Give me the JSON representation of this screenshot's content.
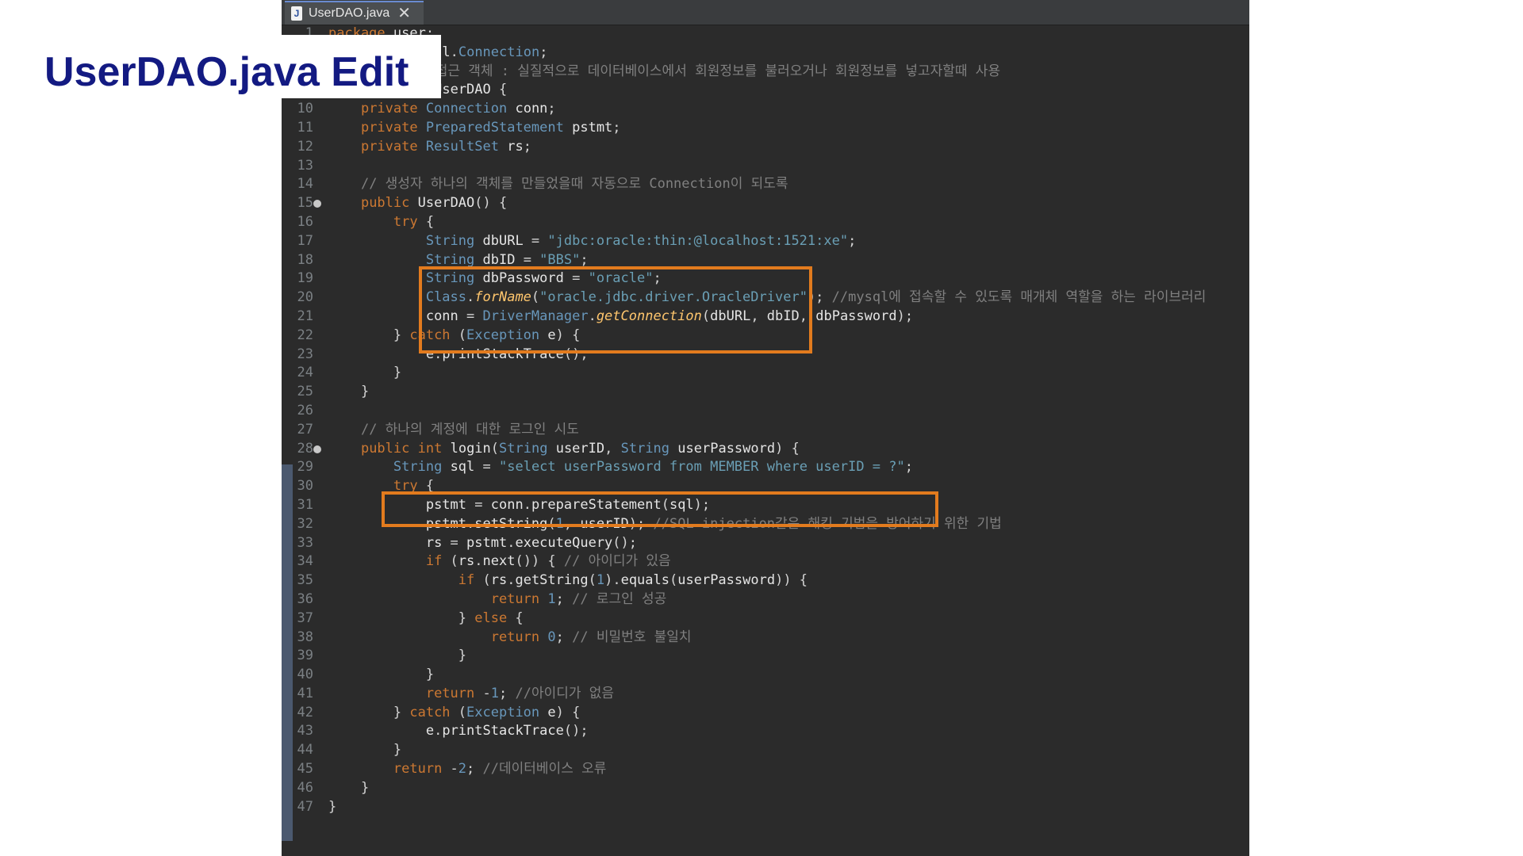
{
  "slide": {
    "title": "UserDAO.java Edit"
  },
  "editor": {
    "tab": {
      "label": "UserDAO.java",
      "icon": "java-file-icon",
      "close_icon": "close-icon"
    },
    "colors": {
      "background": "#2b2b2b",
      "highlight_box": "#e27b1e",
      "title": "#131a82"
    },
    "lines": [
      {
        "n": "1",
        "t": "package user;"
      },
      {
        "n": "3",
        "t": "import java.sql.Connection;"
      },
      {
        "n": "8",
        "t": "// 데이터베이스 접근 객체 : 실질적으로 데이터베이스에서 회원정보를 불러오거나 회원정보를 넣고자할때 사용"
      },
      {
        "n": "9",
        "t": "public class UserDAO {"
      },
      {
        "n": "10",
        "t": "    private Connection conn;"
      },
      {
        "n": "11",
        "t": "    private PreparedStatement pstmt;"
      },
      {
        "n": "12",
        "t": "    private ResultSet rs;"
      },
      {
        "n": "13",
        "t": ""
      },
      {
        "n": "14",
        "t": "    // 생성자 하나의 객체를 만들었을때 자동으로 Connection이 되도록"
      },
      {
        "n": "15",
        "t": "    public UserDAO() {"
      },
      {
        "n": "16",
        "t": "        try {"
      },
      {
        "n": "17",
        "t": "            String dbURL = \"jdbc:oracle:thin:@localhost:1521:xe\";"
      },
      {
        "n": "18",
        "t": "            String dbID = \"BBS\";"
      },
      {
        "n": "19",
        "t": "            String dbPassword = \"oracle\";"
      },
      {
        "n": "20",
        "t": "            Class.forName(\"oracle.jdbc.driver.OracleDriver\"); //mysql에 접속할 수 있도록 매개체 역할을 하는 라이브러리"
      },
      {
        "n": "21",
        "t": "            conn = DriverManager.getConnection(dbURL, dbID, dbPassword);"
      },
      {
        "n": "22",
        "t": "        } catch (Exception e) {"
      },
      {
        "n": "23",
        "t": "            e.printStackTrace();"
      },
      {
        "n": "24",
        "t": "        }"
      },
      {
        "n": "25",
        "t": "    }"
      },
      {
        "n": "26",
        "t": ""
      },
      {
        "n": "27",
        "t": "    // 하나의 계정에 대한 로그인 시도"
      },
      {
        "n": "28",
        "t": "    public int login(String userID, String userPassword) {"
      },
      {
        "n": "29",
        "t": "        String sql = \"select userPassword from MEMBER where userID = ?\";"
      },
      {
        "n": "30",
        "t": "        try {"
      },
      {
        "n": "31",
        "t": "            pstmt = conn.prepareStatement(sql);"
      },
      {
        "n": "32",
        "t": "            pstmt.setString(1, userID); //SQL injection같은 해킹 기법을 방어하기 위한 기법"
      },
      {
        "n": "33",
        "t": "            rs = pstmt.executeQuery();"
      },
      {
        "n": "34",
        "t": "            if (rs.next()) { // 아이디가 있음"
      },
      {
        "n": "35",
        "t": "                if (rs.getString(1).equals(userPassword)) {"
      },
      {
        "n": "36",
        "t": "                    return 1; // 로그인 성공"
      },
      {
        "n": "37",
        "t": "                } else {"
      },
      {
        "n": "38",
        "t": "                    return 0; // 비밀번호 불일치"
      },
      {
        "n": "39",
        "t": "                }"
      },
      {
        "n": "40",
        "t": "            }"
      },
      {
        "n": "41",
        "t": "            return -1; //아이디가 없음"
      },
      {
        "n": "42",
        "t": "        } catch (Exception e) {"
      },
      {
        "n": "43",
        "t": "            e.printStackTrace();"
      },
      {
        "n": "44",
        "t": "        }"
      },
      {
        "n": "45",
        "t": "        return -2; //데이터베이스 오류"
      },
      {
        "n": "46",
        "t": "    }"
      },
      {
        "n": "47",
        "t": "}"
      }
    ]
  }
}
